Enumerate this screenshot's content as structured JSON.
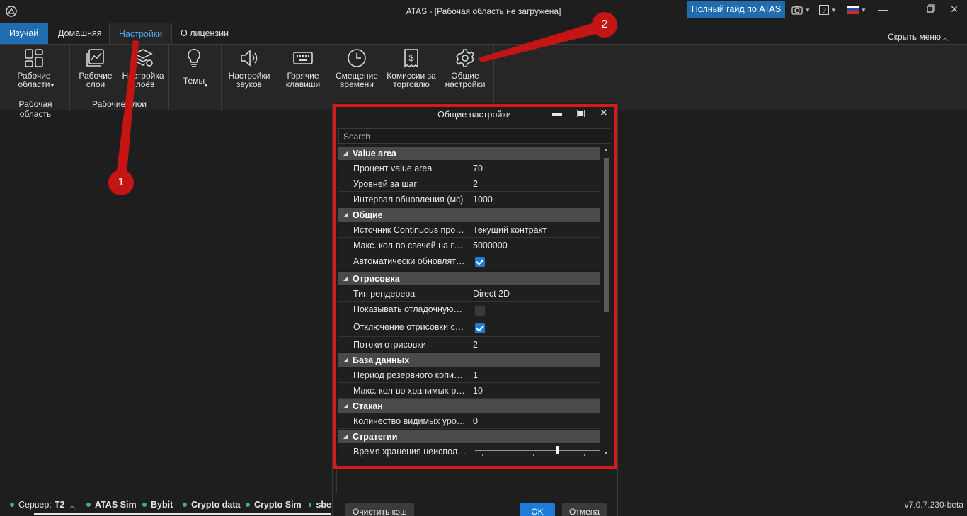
{
  "window": {
    "title": "ATAS - [Рабочая область не загружена]",
    "guide_button": "Полный гайд по ATAS"
  },
  "tabs": [
    {
      "label": "Изучай"
    },
    {
      "label": "Домашняя"
    },
    {
      "label": "Настройки"
    },
    {
      "label": "О лицензии"
    }
  ],
  "hide_menu": "Скрыть меню",
  "ribbon": {
    "workspaces": {
      "label": "Рабочие\nобласти",
      "group": "Рабочая область"
    },
    "layers": {
      "label": "Рабочие\nслои"
    },
    "layer_settings": {
      "label": "Настройка\nслоёв",
      "group": "Рабочие слои"
    },
    "themes": {
      "label": "Темы"
    },
    "sounds": {
      "label": "Настройки\nзвуков"
    },
    "hotkeys": {
      "label": "Горячие\nклавиши"
    },
    "time_offset": {
      "label": "Смещение\nвремени"
    },
    "commissions": {
      "label": "Комиссии за\nторговлю"
    },
    "general": {
      "label": "Общие\nнастройки"
    }
  },
  "dialog": {
    "title": "Общие настройки",
    "search_placeholder": "Search",
    "categories": [
      {
        "name": "Value area",
        "props": [
          {
            "name": "Процент value area",
            "value": "70"
          },
          {
            "name": "Уровней за шаг",
            "value": "2"
          },
          {
            "name": "Интервал обновления (мс)",
            "value": "1000"
          }
        ]
      },
      {
        "name": "Общие",
        "props": [
          {
            "name": "Источник Continuous про…",
            "value": "Текущий контракт"
          },
          {
            "name": "Макс. кол-во свечей на г…",
            "value": "5000000"
          },
          {
            "name": "Автоматически обновлят…",
            "checked": true
          }
        ]
      },
      {
        "name": "Отрисовка",
        "props": [
          {
            "name": "Тип рендерера",
            "value": "Direct 2D"
          },
          {
            "name": "Показывать отладочную…",
            "checked": false
          },
          {
            "name": "Отключение отрисовки с…",
            "checked": true
          },
          {
            "name": "Потоки отрисовки",
            "value": "2"
          }
        ]
      },
      {
        "name": "База данных",
        "props": [
          {
            "name": "Период резервного копи…",
            "value": "1"
          },
          {
            "name": "Макс. кол-во хранимых р…",
            "value": "10"
          }
        ]
      },
      {
        "name": "Стакан",
        "props": [
          {
            "name": "Количество видимых уро…",
            "value": "0"
          }
        ]
      },
      {
        "name": "Стратегии",
        "props": [
          {
            "name": "Время хранения неиспол…",
            "slider_fraction": 0.65
          }
        ]
      }
    ],
    "buttons": {
      "clear_cache": "Очистить кэш",
      "ok": "OK",
      "cancel": "Отмена"
    }
  },
  "annotations": {
    "callout_1": "1",
    "callout_2": "2",
    "accent": "#c51414"
  },
  "statusbar": {
    "server_label": "Сервер:",
    "server_value": "T2",
    "connections": [
      "ATAS Sim",
      "Bybit",
      "Crypto data",
      "Crypto Sim",
      "sbe"
    ],
    "version": "v7.0.7.230-beta"
  },
  "colors": {
    "accent_blue": "#1f6cb0",
    "highlight_red": "#d41a1a",
    "status_green": "#3fb96b"
  }
}
